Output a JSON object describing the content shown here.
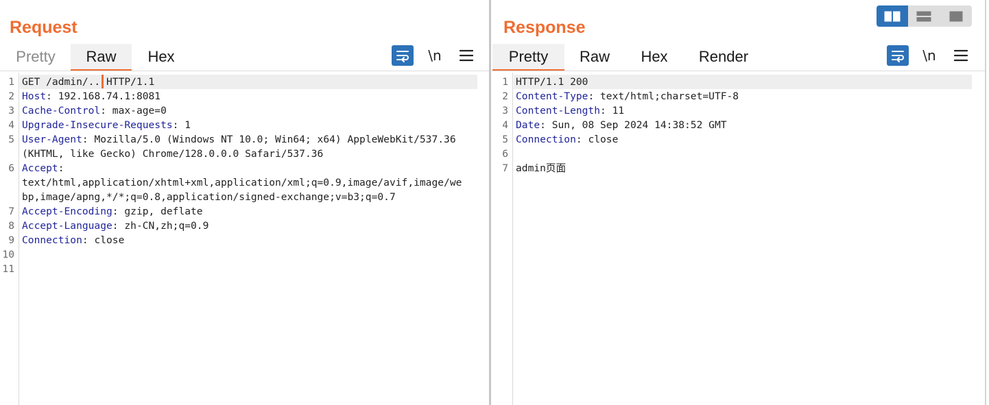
{
  "request": {
    "title": "Request",
    "tabs": [
      "Pretty",
      "Raw",
      "Hex"
    ],
    "active_tab": "Raw",
    "disabled_tab": "Pretty",
    "tools": {
      "newline_label": "\\n"
    },
    "lines": [
      {
        "num": "1",
        "name": "",
        "value": "GET /admin/.. HTTP/1.1"
      },
      {
        "num": "2",
        "name": "Host",
        "value": ": 192.168.74.1:8081"
      },
      {
        "num": "3",
        "name": "Cache-Control",
        "value": ": max-age=0"
      },
      {
        "num": "4",
        "name": "Upgrade-Insecure-Requests",
        "value": ": 1"
      },
      {
        "num": "5",
        "name": "User-Agent",
        "value": ": Mozilla/5.0 (Windows NT 10.0; Win64; x64) AppleWebKit/537.36"
      },
      {
        "num": "",
        "name": "",
        "value": "(KHTML, like Gecko) Chrome/128.0.0.0 Safari/537.36"
      },
      {
        "num": "6",
        "name": "Accept",
        "value": ":"
      },
      {
        "num": "",
        "name": "",
        "value": "text/html,application/xhtml+xml,application/xml;q=0.9,image/avif,image/we"
      },
      {
        "num": "",
        "name": "",
        "value": "bp,image/apng,*/*;q=0.8,application/signed-exchange;v=b3;q=0.7"
      },
      {
        "num": "7",
        "name": "Accept-Encoding",
        "value": ": gzip, deflate"
      },
      {
        "num": "8",
        "name": "Accept-Language",
        "value": ": zh-CN,zh;q=0.9"
      },
      {
        "num": "9",
        "name": "Connection",
        "value": ": close"
      },
      {
        "num": "10",
        "name": "",
        "value": ""
      },
      {
        "num": "11",
        "name": "",
        "value": ""
      }
    ]
  },
  "response": {
    "title": "Response",
    "tabs": [
      "Pretty",
      "Raw",
      "Hex",
      "Render"
    ],
    "active_tab": "Pretty",
    "tools": {
      "newline_label": "\\n"
    },
    "lines": [
      {
        "num": "1",
        "name": "",
        "value": "HTTP/1.1 200"
      },
      {
        "num": "2",
        "name": "Content-Type",
        "value": ": text/html;charset=UTF-8"
      },
      {
        "num": "3",
        "name": "Content-Length",
        "value": ": 11"
      },
      {
        "num": "4",
        "name": "Date",
        "value": ": Sun, 08 Sep 2024 14:38:52 GMT"
      },
      {
        "num": "5",
        "name": "Connection",
        "value": ": close"
      },
      {
        "num": "6",
        "name": "",
        "value": ""
      },
      {
        "num": "7",
        "name": "",
        "value": "admin页面"
      }
    ]
  },
  "view_switch": {
    "options": [
      "side-by-side-icon",
      "stacked-icon",
      "single-pane-icon"
    ],
    "active": "side-by-side-icon"
  },
  "colors": {
    "accent": "#ef6d32",
    "header_name": "#21259a",
    "button_blue": "#2d72b8"
  }
}
